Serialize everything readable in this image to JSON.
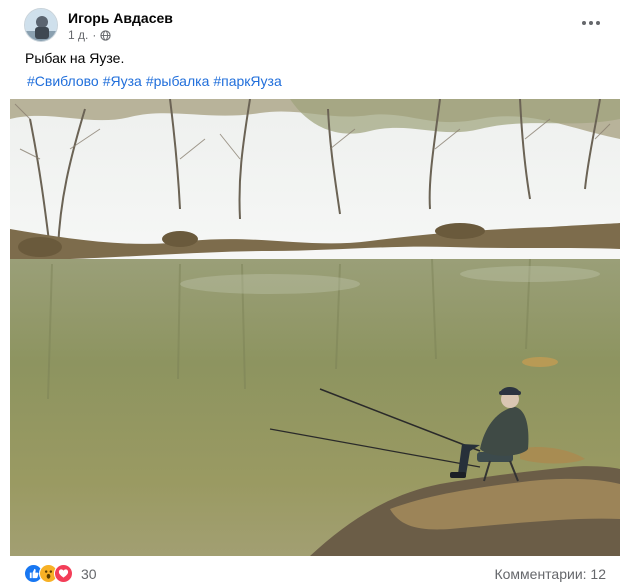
{
  "post": {
    "author": "Игорь Авдасев",
    "time": "1 д.",
    "privacy_icon": "globe-icon",
    "text": "Рыбак на Яузе.",
    "hashtags": [
      "#Свиблово",
      "#Яуза",
      "#рыбалка",
      "#паркЯуза"
    ],
    "photo_subject": "fisherman-by-river"
  },
  "footer": {
    "reactions": [
      "like-icon",
      "wow-icon",
      "love-icon"
    ],
    "reaction_count": "30",
    "comments_label": "Комментарии: 12"
  },
  "colors": {
    "link": "#216fdb",
    "secondary_text": "#65676b",
    "like": "#1877f2",
    "love": "#f33e58",
    "wow": "#f7b125"
  }
}
